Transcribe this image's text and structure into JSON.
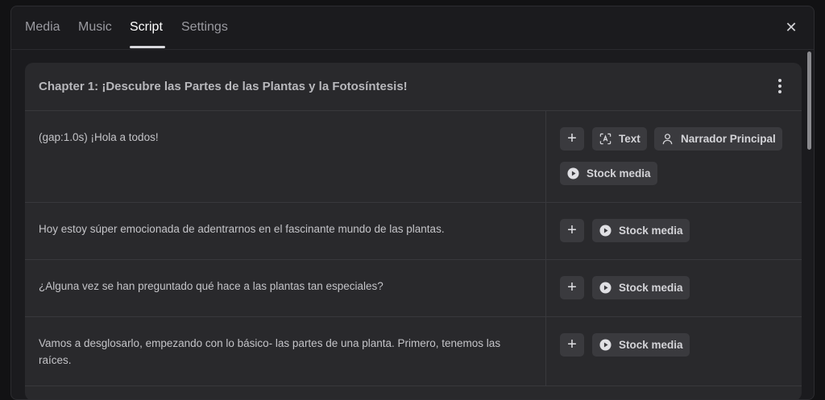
{
  "tabs": [
    {
      "label": "Media"
    },
    {
      "label": "Music"
    },
    {
      "label": "Script",
      "active": true
    },
    {
      "label": "Settings"
    }
  ],
  "close_glyph": "✕",
  "chapter": {
    "title": "Chapter 1: ¡Descubre las Partes de las Plantas y la Fotosíntesis!"
  },
  "rows": [
    {
      "text": "(gap:1.0s) ¡Hola a todos!",
      "actions": {
        "plus": "+",
        "text_label": "Text",
        "narrator_label": "Narrador Principal",
        "stock_label": "Stock media"
      }
    },
    {
      "text": "Hoy estoy súper emocionada de adentrarnos en el fascinante mundo de las plantas.",
      "actions": {
        "plus": "+",
        "stock_label": "Stock media"
      }
    },
    {
      "text": "¿Alguna vez se han preguntado qué hace a las plantas tan especiales?",
      "actions": {
        "plus": "+",
        "stock_label": "Stock media"
      }
    },
    {
      "text": "Vamos a desglosarlo, empezando con lo básico- las partes de una planta. Primero, tenemos las raíces.",
      "actions": {
        "plus": "+",
        "stock_label": "Stock media"
      }
    }
  ],
  "colors": {
    "background": "#1b1b1e",
    "card": "#29292c",
    "chip": "#3a3a3e"
  }
}
